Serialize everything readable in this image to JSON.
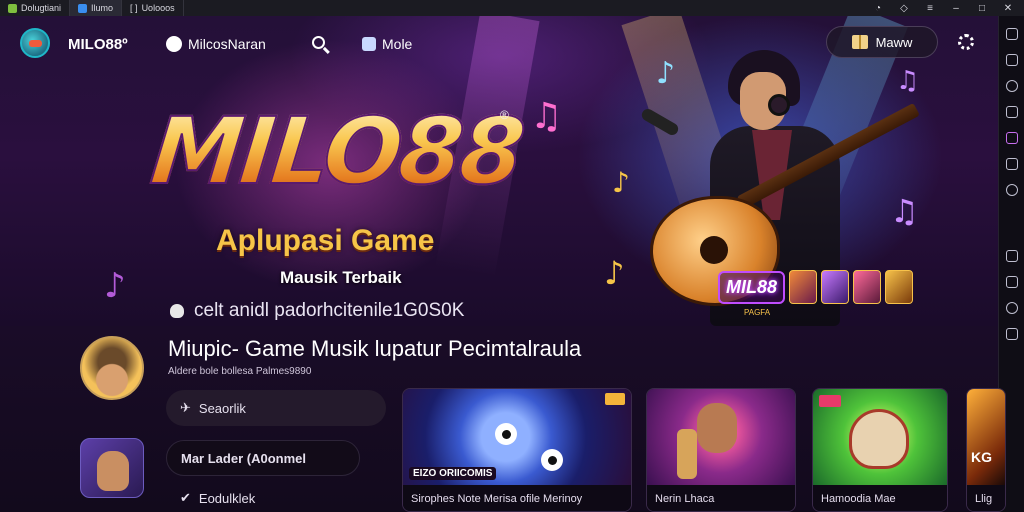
{
  "titlebar": {
    "tabs": [
      {
        "label": "Dolugtiani"
      },
      {
        "label": "Ilumo"
      },
      {
        "label": "Uolooos"
      }
    ]
  },
  "nav": {
    "brand": "MILO88º",
    "user_name": "MilcosNaran",
    "profile_label": "Mole",
    "promo_button": "Maww"
  },
  "hero": {
    "logo_text": "MILO88",
    "registered": "®",
    "subtitle": "Aplupasi Game",
    "subtitle2": "Mausik Terbaik",
    "tagline": "celt anidl padorhcitenile1G0S0K",
    "mini_logo": "MIL88",
    "mini_caption": "PAGFA"
  },
  "section": {
    "title": "Miupic- Game Musik lupatur Pecimtalraula",
    "subtitle": "Aldere bole bollesa Palmes9890",
    "search_pill": "Seaorlik",
    "featured_pill": "Mar Lader (A0onmel",
    "bottom_pill": "Eodulklek"
  },
  "cards": [
    {
      "banner": "EIZO ORIICOMIS",
      "caption": "Sirophes Note Merisa ofile Merinoy"
    },
    {
      "caption": "Nerin Lhaca"
    },
    {
      "caption": "Hamoodia Mae"
    },
    {
      "big_text": "KG",
      "caption": "Llig"
    }
  ],
  "colors": {
    "gold": "#f6c548",
    "accent_purple": "#c04dff",
    "bg": "#14081f"
  }
}
